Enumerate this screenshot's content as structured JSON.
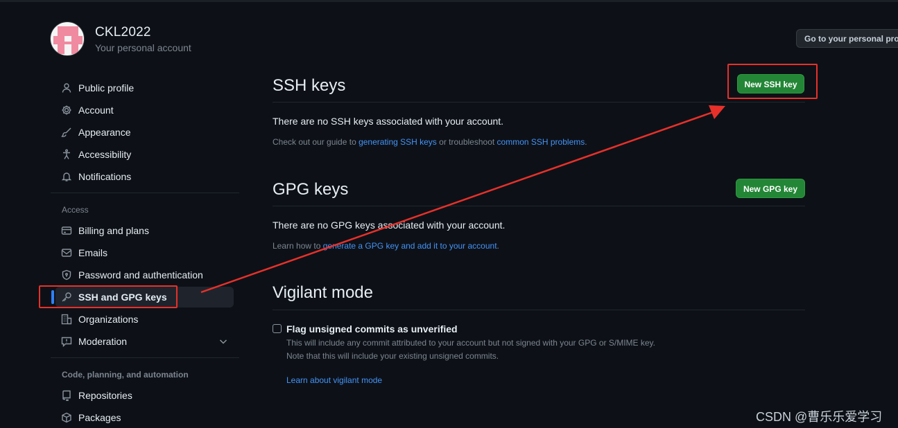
{
  "user": {
    "name": "CKL2022",
    "subtitle": "Your personal account",
    "go_button": "Go to your personal profile"
  },
  "sidebar": {
    "items": [
      {
        "label": "Public profile",
        "icon": "person-icon"
      },
      {
        "label": "Account",
        "icon": "gear-icon"
      },
      {
        "label": "Appearance",
        "icon": "paintbrush-icon"
      },
      {
        "label": "Accessibility",
        "icon": "accessibility-icon"
      },
      {
        "label": "Notifications",
        "icon": "bell-icon"
      }
    ],
    "access_heading": "Access",
    "access_items": [
      {
        "label": "Billing and plans",
        "icon": "credit-card-icon"
      },
      {
        "label": "Emails",
        "icon": "mail-icon"
      },
      {
        "label": "Password and authentication",
        "icon": "shield-lock-icon"
      },
      {
        "label": "SSH and GPG keys",
        "icon": "key-icon",
        "active": true
      },
      {
        "label": "Organizations",
        "icon": "organization-icon"
      },
      {
        "label": "Moderation",
        "icon": "report-icon"
      }
    ],
    "code_heading": "Code, planning, and automation",
    "code_items": [
      {
        "label": "Repositories",
        "icon": "repo-icon"
      },
      {
        "label": "Packages",
        "icon": "package-icon"
      }
    ]
  },
  "ssh": {
    "title": "SSH keys",
    "button": "New SSH key",
    "empty": "There are no SSH keys associated with your account.",
    "hint_prefix": "Check out our guide to ",
    "hint_link1": "generating SSH keys",
    "hint_mid": " or troubleshoot ",
    "hint_link2": "common SSH problems",
    "hint_suffix": "."
  },
  "gpg": {
    "title": "GPG keys",
    "button": "New GPG key",
    "empty": "There are no GPG keys associated with your account.",
    "hint_prefix": "Learn how to ",
    "hint_link": "generate a GPG key and add it to your account",
    "hint_suffix": "."
  },
  "vigilant": {
    "title": "Vigilant mode",
    "checkbox_label": "Flag unsigned commits as unverified",
    "desc1": "This will include any commit attributed to your account but not signed with your GPG or S/MIME key.",
    "desc2": "Note that this will include your existing unsigned commits.",
    "link": "Learn about vigilant mode",
    "checked": false
  },
  "watermark": "CSDN @曹乐乐爱学习",
  "colors": {
    "background": "#0d1117",
    "accent_green": "#238636",
    "link": "#4493f8",
    "annotation_red": "#e8302a",
    "active_bar": "#2f81f7"
  }
}
